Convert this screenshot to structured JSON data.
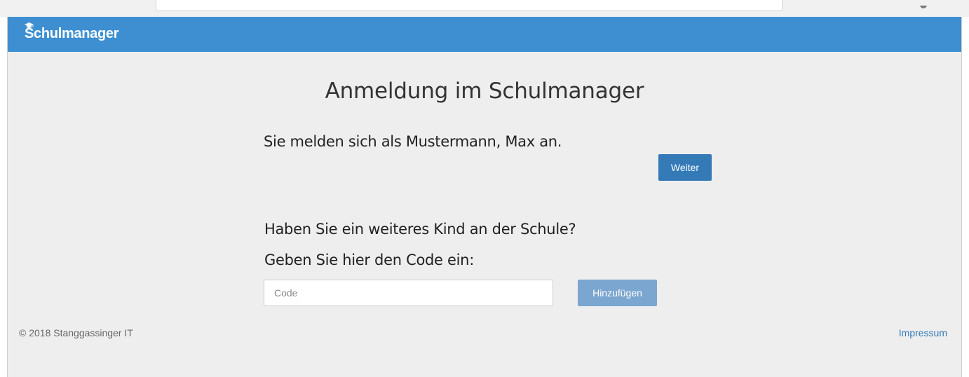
{
  "app": {
    "brand": "Schulmanager",
    "brand_icon": "graduation-cap-icon",
    "brand_color": "#3d8fd1"
  },
  "page": {
    "title": "Anmeldung im Schulmanager",
    "login_message": "Sie melden sich als Mustermann, Max an.",
    "continue_button": "Weiter",
    "question": "Haben Sie ein weiteres Kind an der Schule?",
    "code_hint": "Geben Sie hier den Code ein:",
    "code_input": {
      "placeholder": "Code",
      "value": ""
    },
    "add_button": "Hinzufügen"
  },
  "footer": {
    "copyright": "© 2018 Stanggassinger IT",
    "impressum": "Impressum"
  }
}
